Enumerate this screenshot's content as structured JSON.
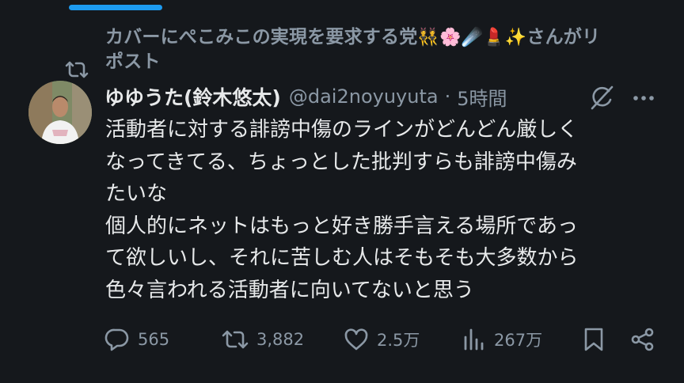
{
  "repost": {
    "text": "カバーにぺこみこの実現を要求する党",
    "emoji": "👯🌸☄️💄✨",
    "suffix_line1": "さんがリ",
    "suffix_line2": "ポスト"
  },
  "tweet": {
    "display_name": "ゆゆうた(鈴木悠太)",
    "handle": "@dai2noyuyuta",
    "separator": "·",
    "time": "5時間",
    "lines": [
      "活動者に対する誹謗中傷のラインがどんどん厳しく",
      "なってきてる、ちょっとした批判すらも誹謗中傷み",
      "たいな",
      "個人的にネットはもっと好き勝手言える場所であっ",
      "て欲しいし、それに苦しむ人はそもそも大多数から",
      "色々言われる活動者に向いてないと思う"
    ]
  },
  "actions": {
    "replies": "565",
    "reposts": "3,882",
    "likes": "2.5万",
    "views": "267万"
  },
  "icons": {
    "repost_context": "repost-icon",
    "grok": "grok-icon",
    "more": "more-icon",
    "reply": "reply-icon",
    "repost": "repost-icon",
    "like": "heart-icon",
    "views": "views-icon",
    "bookmark": "bookmark-icon",
    "share": "share-icon"
  },
  "colors": {
    "background": "#15181c",
    "text": "#e7e9ea",
    "secondary": "#8b98a5",
    "accent": "#1d9bf0"
  }
}
